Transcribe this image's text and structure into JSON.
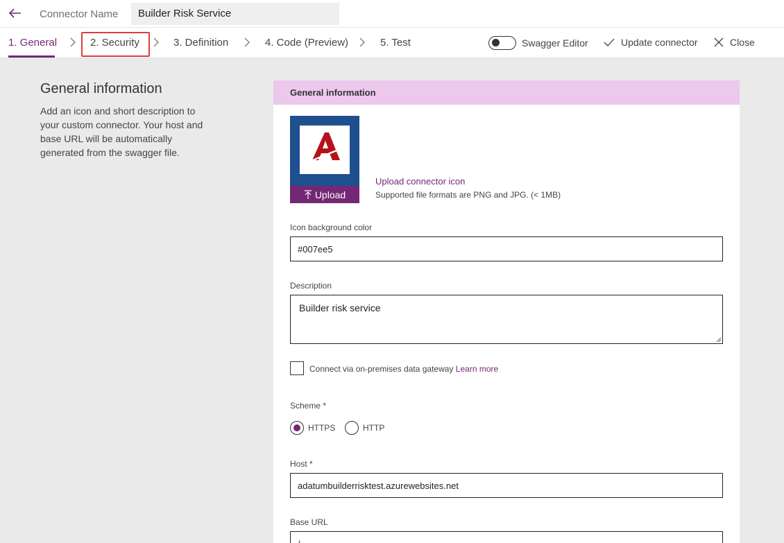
{
  "header": {
    "connector_label": "Connector Name",
    "connector_name": "Builder Risk Service"
  },
  "nav": {
    "steps": [
      {
        "label": "1. General"
      },
      {
        "label": "2. Security"
      },
      {
        "label": "3. Definition"
      },
      {
        "label": "4. Code (Preview)"
      },
      {
        "label": "5. Test"
      }
    ],
    "active_step": "1. General",
    "swagger_toggle_label": "Swagger Editor",
    "swagger_enabled": false,
    "update_label": "Update connector",
    "close_label": "Close"
  },
  "info": {
    "title": "General information",
    "description": "Add an icon and short description to your custom connector. Your host and base URL will be automatically generated from the swagger file."
  },
  "panel": {
    "header": "General information",
    "upload_button_label": "Upload",
    "upload_link": "Upload connector icon",
    "upload_hint": "Supported file formats are PNG and JPG. (< 1MB)",
    "icon_bg_label": "Icon background color",
    "icon_bg_value": "#007ee5",
    "description_label": "Description",
    "description_value": "Builder risk service",
    "gateway_label": "Connect via on-premises data gateway",
    "gateway_checked": false,
    "learn_more": "Learn more",
    "scheme_label": "Scheme *",
    "scheme_options": [
      "HTTPS",
      "HTTP"
    ],
    "scheme_selected": "HTTPS",
    "host_label": "Host *",
    "host_value": "adatumbuilderrisktest.azurewebsites.net",
    "base_url_label": "Base URL",
    "base_url_value": "/"
  },
  "colors": {
    "accent": "#742774",
    "panel_header_bg": "#ecc8ec",
    "icon_tile_bg": "#1e4f8f",
    "logo_red": "#b5121b",
    "highlight": "#e03c3c"
  }
}
